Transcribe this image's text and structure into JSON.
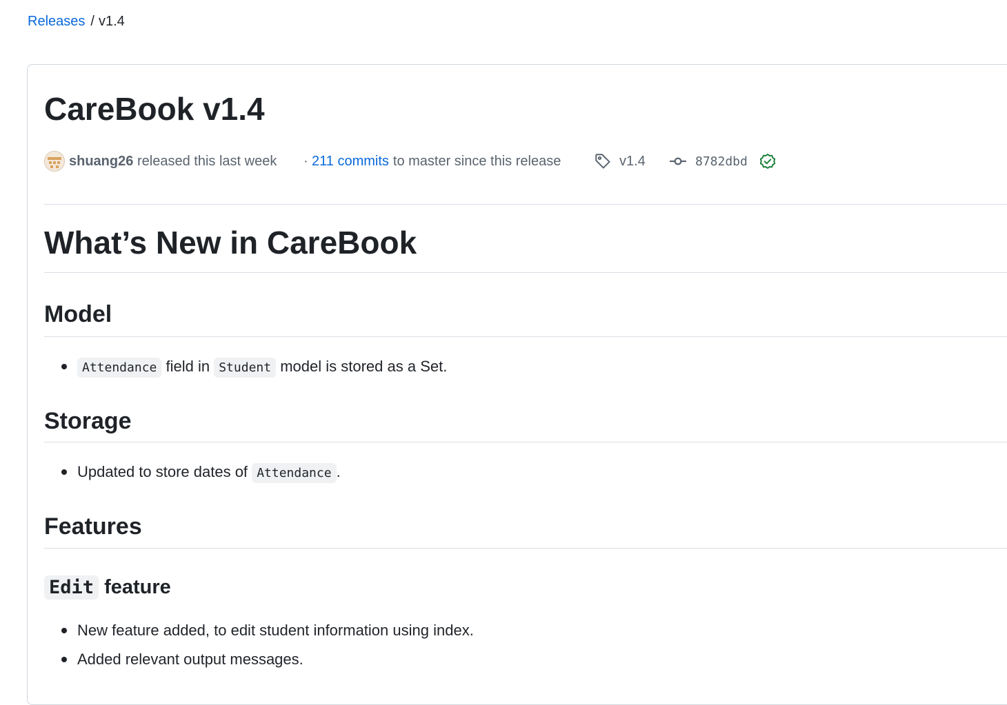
{
  "breadcrumb": {
    "link": "Releases",
    "separator": "/",
    "current": "v1.4"
  },
  "release": {
    "title": "CareBook v1.4",
    "author": "shuang26",
    "released_text": "released this last week",
    "dot": "·",
    "commits_link": "211 commits",
    "commits_text": "to master since this release",
    "tag": "v1.4",
    "commit_sha": "8782dbd"
  },
  "notes": {
    "heading": "What’s New in CareBook",
    "model": {
      "heading": "Model",
      "item": {
        "code1": "Attendance",
        "t1": "field in",
        "code2": "Student",
        "t2": "model is stored as a Set."
      }
    },
    "storage": {
      "heading": "Storage",
      "item": {
        "t1": "Updated to store dates of",
        "code1": "Attendance",
        "t2": "."
      }
    },
    "features": {
      "heading": "Features",
      "edit": {
        "code": "Edit",
        "text": "feature",
        "items": [
          "New feature added, to edit student information using index.",
          "Added relevant output messages."
        ]
      }
    }
  },
  "colors": {
    "link": "#0969da",
    "text": "#1f2328",
    "muted": "#59636e",
    "border": "#d0d7de",
    "success": "#1a7f37"
  },
  "icons": [
    "tag-icon",
    "git-commit-icon",
    "verified-check-icon"
  ]
}
